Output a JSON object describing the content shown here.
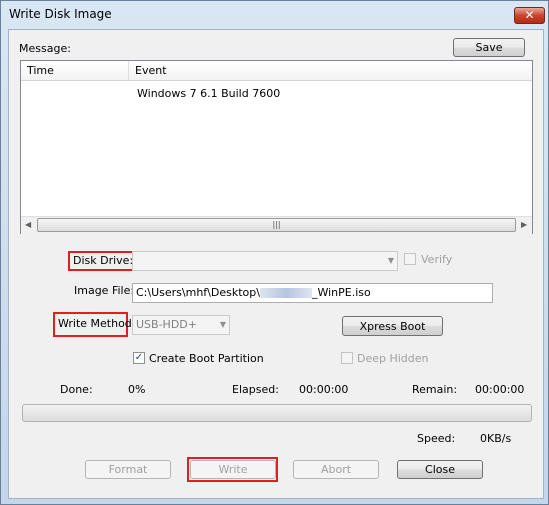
{
  "window": {
    "title": "Write Disk Image",
    "close_glyph": "✕"
  },
  "message": {
    "label": "Message:",
    "save_label": "Save",
    "columns": [
      "Time",
      "Event"
    ],
    "rows": [
      {
        "time": "",
        "event": "Windows 7 6.1 Build 7600"
      }
    ]
  },
  "disk_drive": {
    "label": "Disk Drive:",
    "value": "",
    "verify_label": "Verify",
    "verify_checked": false
  },
  "image_file": {
    "label": "Image File:",
    "value": "C:\\Users\\mhf\\Desktop\\",
    "value_tail": "_WinPE.iso"
  },
  "write_method": {
    "label": "Write Method:",
    "value": "USB-HDD+",
    "xpress_boot_label": "Xpress Boot"
  },
  "options": {
    "create_boot_partition_label": "Create Boot Partition",
    "create_boot_partition_checked": true,
    "deep_hidden_label": "Deep Hidden",
    "deep_hidden_checked": false
  },
  "status": {
    "done_label": "Done:",
    "done_value": "0%",
    "elapsed_label": "Elapsed:",
    "elapsed_value": "00:00:00",
    "remain_label": "Remain:",
    "remain_value": "00:00:00",
    "speed_label": "Speed:",
    "speed_value": "0KB/s",
    "progress_percent": 0
  },
  "actions": {
    "format_label": "Format",
    "write_label": "Write",
    "abort_label": "Abort",
    "close_label": "Close"
  },
  "icons": {
    "checkmark": "✓",
    "dropdown": "▼",
    "scroll_left": "◀",
    "scroll_right": "▶",
    "scroll_grip": "|||"
  },
  "colors": {
    "highlight_border": "#e02020"
  }
}
